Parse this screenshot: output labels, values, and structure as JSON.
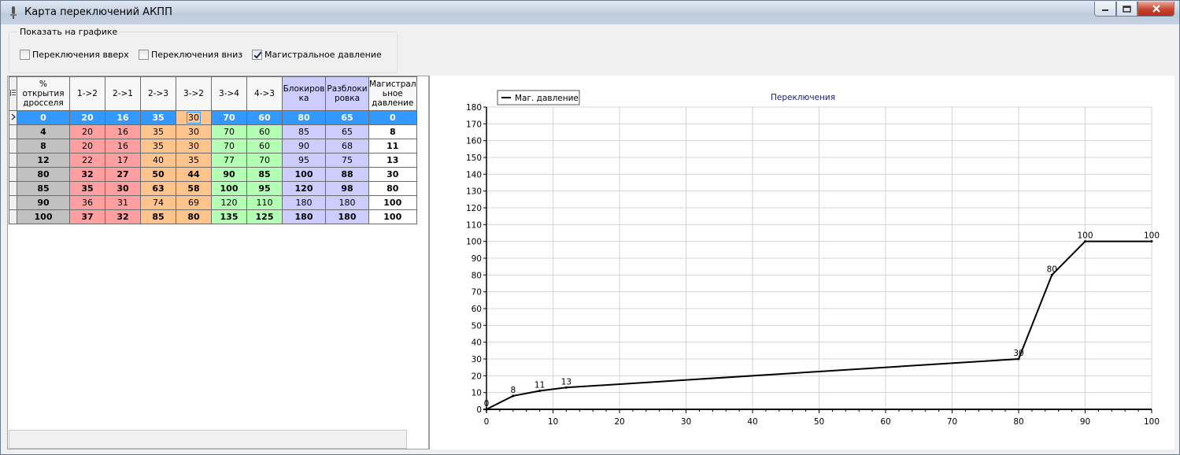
{
  "window": {
    "title": "Карта переключений АКПП"
  },
  "show_group": {
    "title": "Показать на графике",
    "items": [
      {
        "label": "Переключения вверх",
        "checked": false
      },
      {
        "label": "Переключения вниз",
        "checked": false
      },
      {
        "label": "Магистральное давление",
        "checked": true
      }
    ]
  },
  "grid": {
    "headers": [
      "% открытия дросселя",
      "1->2",
      "2->1",
      "2->3",
      "3->2",
      "3->4",
      "4->3",
      "Блокиров ка",
      "Разблоки ровка",
      "Магистрал ьное давление"
    ],
    "rows": [
      [
        "0",
        "20",
        "16",
        "35",
        "30",
        "70",
        "60",
        "80",
        "65",
        "0"
      ],
      [
        "4",
        "20",
        "16",
        "35",
        "30",
        "70",
        "60",
        "85",
        "65",
        "8"
      ],
      [
        "8",
        "20",
        "16",
        "35",
        "30",
        "70",
        "60",
        "90",
        "68",
        "11"
      ],
      [
        "12",
        "22",
        "17",
        "40",
        "35",
        "77",
        "70",
        "95",
        "75",
        "13"
      ],
      [
        "80",
        "32",
        "27",
        "50",
        "44",
        "90",
        "85",
        "100",
        "88",
        "30"
      ],
      [
        "85",
        "35",
        "30",
        "63",
        "58",
        "100",
        "95",
        "120",
        "98",
        "80"
      ],
      [
        "90",
        "36",
        "31",
        "74",
        "69",
        "120",
        "110",
        "180",
        "180",
        "100"
      ],
      [
        "100",
        "37",
        "32",
        "85",
        "80",
        "135",
        "125",
        "180",
        "180",
        "100"
      ]
    ]
  },
  "chart_data": {
    "type": "line",
    "title": "Переключения",
    "xlabel": "",
    "ylabel": "",
    "xlim": [
      0,
      100
    ],
    "ylim": [
      0,
      180
    ],
    "xticks": [
      0,
      10,
      20,
      30,
      40,
      50,
      60,
      70,
      80,
      90,
      100
    ],
    "yticks": [
      0,
      10,
      20,
      30,
      40,
      50,
      60,
      70,
      80,
      90,
      100,
      110,
      120,
      130,
      140,
      150,
      160,
      170,
      180
    ],
    "grid": true,
    "legend_position": "top-left",
    "series": [
      {
        "name": "Маг. давление",
        "color": "#000000",
        "x": [
          0,
          4,
          8,
          12,
          80,
          85,
          90,
          100
        ],
        "y": [
          0,
          8,
          11,
          13,
          30,
          80,
          100,
          100
        ]
      }
    ]
  }
}
